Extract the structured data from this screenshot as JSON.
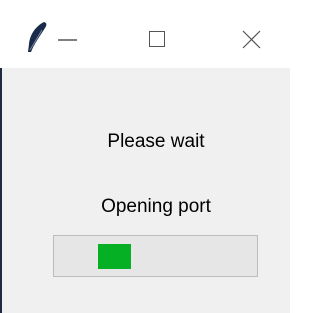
{
  "window": {
    "icon": "feather-icon",
    "controls": {
      "minimize_icon": "minimize-icon",
      "maximize_icon": "maximize-icon",
      "close_icon": "close-icon"
    }
  },
  "dialog": {
    "line1": "Please wait",
    "line2": "Opening port"
  },
  "progress": {
    "mode": "indeterminate",
    "color": "#06b025"
  }
}
